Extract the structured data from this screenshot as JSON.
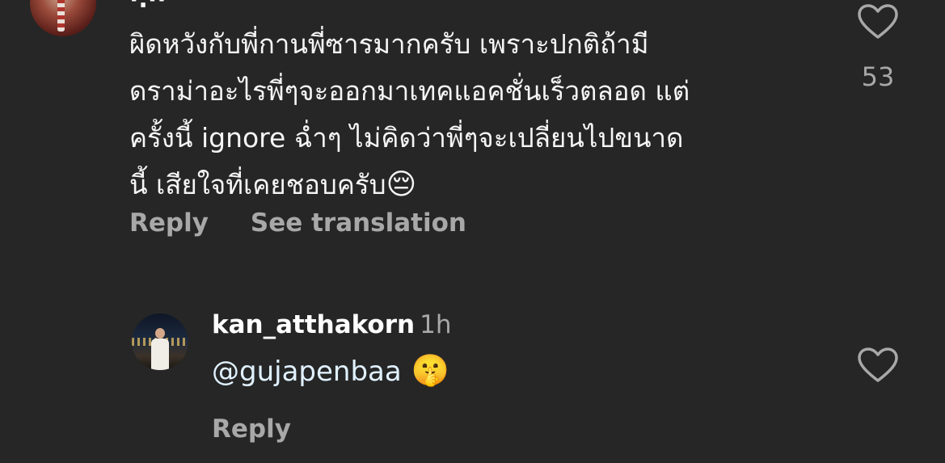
{
  "comment": {
    "username_partial": "·.··",
    "text": "ผิดหวังกับพี่กานพี่ซารมากครับ เพราะปกติถ้ามี\nดราม่าอะไรพี่ๆจะออกมาเทคแอคชั่นเร็วตลอด แต่\nครั้งนี้ ignore ฉ่ำๆ ไม่คิดว่าพี่ๆจะเปลี่ยนไปขนาด\nนี้ เสียใจที่เคยชอบครับ",
    "emoji": "😔",
    "reply_label": "Reply",
    "translate_label": "See translation",
    "like_count": "53",
    "like_icon": "heart-outline-icon"
  },
  "reply": {
    "username": "kan_atthakorn",
    "time": "1h",
    "mention": "@gujapenbaa",
    "emoji": "🤫",
    "reply_label": "Reply",
    "like_icon": "heart-outline-icon"
  },
  "colors": {
    "background": "#262626",
    "text": "#f5f5f5",
    "secondary": "#a8a8a8",
    "mention": "#e0f1ff"
  }
}
